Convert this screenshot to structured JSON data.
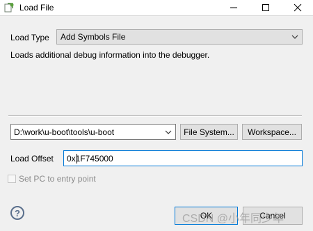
{
  "window": {
    "title": "Load File",
    "minimize_icon": "minimize-icon",
    "maximize_icon": "maximize-icon",
    "close_icon": "close-icon"
  },
  "load_type": {
    "label": "Load Type",
    "selected": "Add Symbols File",
    "description": "Loads additional debug information into the debugger."
  },
  "file": {
    "path": "D:\\work\\u-boot\\tools\\u-boot",
    "file_system_button": "File System...",
    "workspace_button": "Workspace..."
  },
  "offset": {
    "label": "Load Offset",
    "value": "0x1F745000"
  },
  "options": {
    "set_pc_label": "Set PC to entry point",
    "set_pc_checked": false
  },
  "footer": {
    "help_icon": "help-icon",
    "help_glyph": "?",
    "ok_label": "OK",
    "cancel_label": "Cancel",
    "watermark": "CSDN @小年同少年"
  },
  "colors": {
    "focus": "#0078d7",
    "background": "#f0f0f0"
  }
}
